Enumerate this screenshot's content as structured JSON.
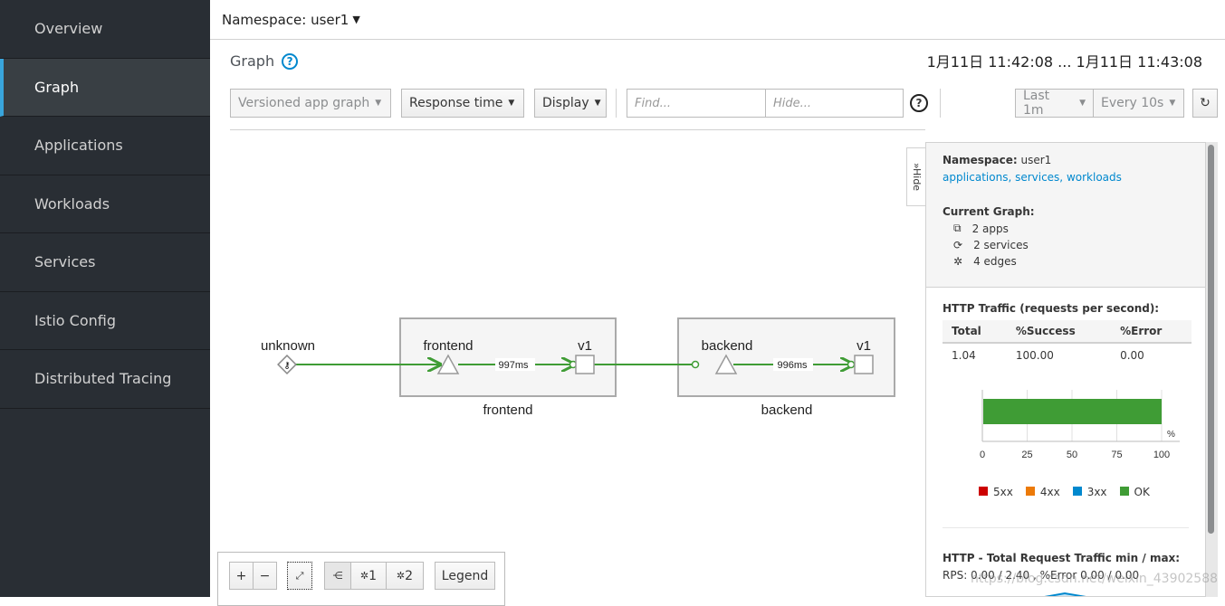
{
  "sidebar": {
    "items": [
      {
        "label": "Overview"
      },
      {
        "label": "Graph",
        "active": true
      },
      {
        "label": "Applications"
      },
      {
        "label": "Workloads"
      },
      {
        "label": "Services"
      },
      {
        "label": "Istio Config"
      },
      {
        "label": "Distributed Tracing"
      }
    ]
  },
  "topbar": {
    "namespace": "Namespace: user1"
  },
  "graph_header": {
    "title": "Graph",
    "time_range": "1月11日 11:42:08 ... 1月11日 11:43:08"
  },
  "toolbar": {
    "graph_type": "Versioned app graph",
    "edge_label": "Response time",
    "display": "Display",
    "find_placeholder": "Find...",
    "hide_placeholder": "Hide...",
    "duration": "Last 1m",
    "refresh": "Every 10s"
  },
  "graph": {
    "nodes": {
      "unknown": "unknown",
      "frontend_app": "frontend",
      "frontend_version": "v1",
      "frontend_box": "frontend",
      "backend_app": "backend",
      "backend_version": "v1",
      "backend_box": "backend"
    },
    "edges": {
      "frontend": "997ms",
      "backend": "996ms"
    },
    "edge_color": "#3f9c35"
  },
  "side_panel": {
    "hide_label": "Hide",
    "namespace_label": "Namespace:",
    "namespace": "user1",
    "links": "applications, services, workloads",
    "current_graph": "Current Graph:",
    "apps": "2 apps",
    "services": "2 services",
    "edges": "4 edges",
    "traffic_title": "HTTP Traffic (requests per second):",
    "table": {
      "headers": [
        "Total",
        "%Success",
        "%Error"
      ],
      "row": [
        "1.04",
        "100.00",
        "0.00"
      ]
    },
    "chart_data": {
      "type": "bar",
      "categories": [
        "OK"
      ],
      "values": [
        100
      ],
      "xlim": [
        0,
        100
      ],
      "ticks": [
        "0",
        "25",
        "50",
        "75",
        "100"
      ],
      "unit": "%",
      "legend": [
        {
          "name": "5xx",
          "color": "#cc0000"
        },
        {
          "name": "4xx",
          "color": "#ec7a08"
        },
        {
          "name": "3xx",
          "color": "#0088ce"
        },
        {
          "name": "OK",
          "color": "#3f9c35"
        }
      ]
    },
    "total_title": "HTTP - Total Request Traffic min / max:",
    "total_values": "RPS: 0.00 / 2.40 , %Error 0.00 / 0.00"
  },
  "bottom_tools": {
    "zoom_in": "+",
    "zoom_out": "−",
    "layout1": "1",
    "layout2": "2",
    "legend": "Legend"
  },
  "watermark": "https://blog.csdn.net/weixin_43902588"
}
